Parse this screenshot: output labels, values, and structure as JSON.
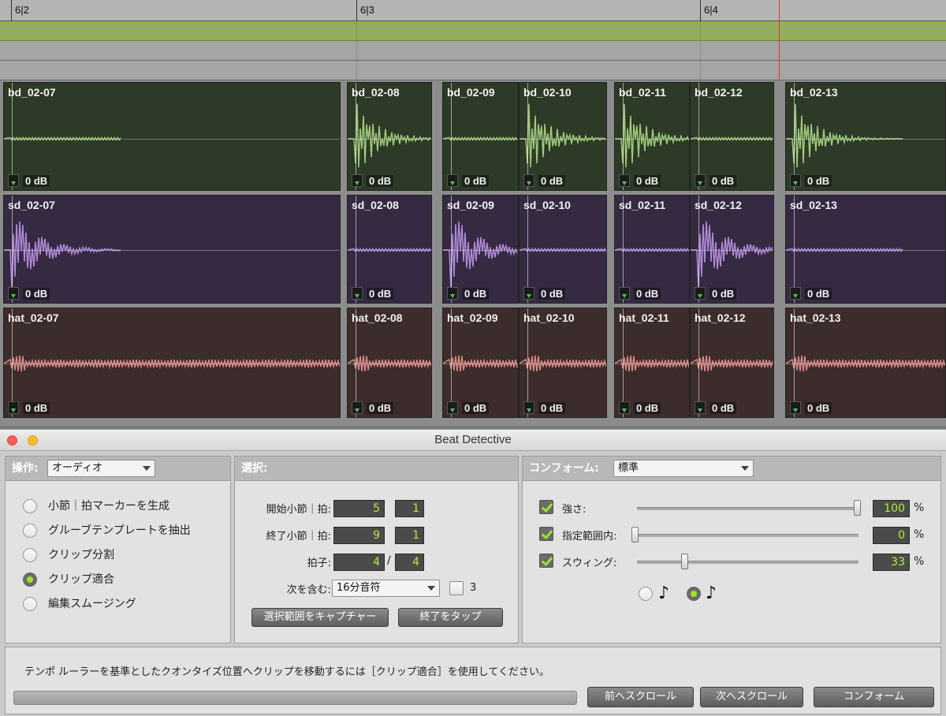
{
  "ruler": {
    "marks": [
      "6|2",
      "6|3",
      "6|4"
    ]
  },
  "tracks": {
    "bd": [
      "bd_02-07",
      "bd_02-08",
      "bd_02-09",
      "bd_02-10",
      "bd_02-11",
      "bd_02-12",
      "bd_02-13"
    ],
    "sd": [
      "sd_02-07",
      "sd_02-08",
      "sd_02-09",
      "sd_02-10",
      "sd_02-11",
      "sd_02-12",
      "sd_02-13"
    ],
    "hat": [
      "hat_02-07",
      "hat_02-08",
      "hat_02-09",
      "hat_02-10",
      "hat_02-11",
      "hat_02-12",
      "hat_02-13"
    ],
    "gain_label": "0 dB",
    "colors": {
      "bd_wave": "#9fc97a",
      "sd_wave": "#b08ad8",
      "hat_wave": "#d88a86"
    }
  },
  "window": {
    "title": "Beat Detective",
    "operation": {
      "label": "操作:",
      "selected": "オーディオ",
      "options": [
        {
          "label": "小節｜拍マーカーを生成",
          "selected": false
        },
        {
          "label": "グルーブテンプレートを抽出",
          "selected": false
        },
        {
          "label": "クリップ分割",
          "selected": false
        },
        {
          "label": "クリップ適合",
          "selected": true
        },
        {
          "label": "編集スムージング",
          "selected": false
        }
      ]
    },
    "selection": {
      "label": "選択:",
      "start_label": "開始小節｜拍:",
      "start_bar": "5",
      "start_beat": "1",
      "end_label": "終了小節｜拍:",
      "end_bar": "9",
      "end_beat": "1",
      "meter_label": "拍子:",
      "meter_num": "4",
      "meter_sep": "/",
      "meter_den": "4",
      "contains_label": "次を含む:",
      "contains_value": "16分音符",
      "triplet_label": "3",
      "capture_button": "選択範囲をキャプチャー",
      "tap_end_button": "終了をタップ"
    },
    "conform": {
      "label": "コンフォーム:",
      "selected": "標準",
      "strength_label": "強さ:",
      "strength_value": "100",
      "exclude_label": "指定範囲内:",
      "exclude_value": "0",
      "swing_label": "スウィング:",
      "swing_value": "33",
      "percent": "%",
      "note_eighth": "♪",
      "note_sixteenth": "♪"
    },
    "status": "テンポ ルーラーを基準としたクオンタイズ位置へクリップを移動するには［クリップ適合］を使用してください。",
    "buttons": {
      "scroll_prev": "前へスクロール",
      "scroll_next": "次へスクロール",
      "conform": "コンフォーム"
    }
  }
}
